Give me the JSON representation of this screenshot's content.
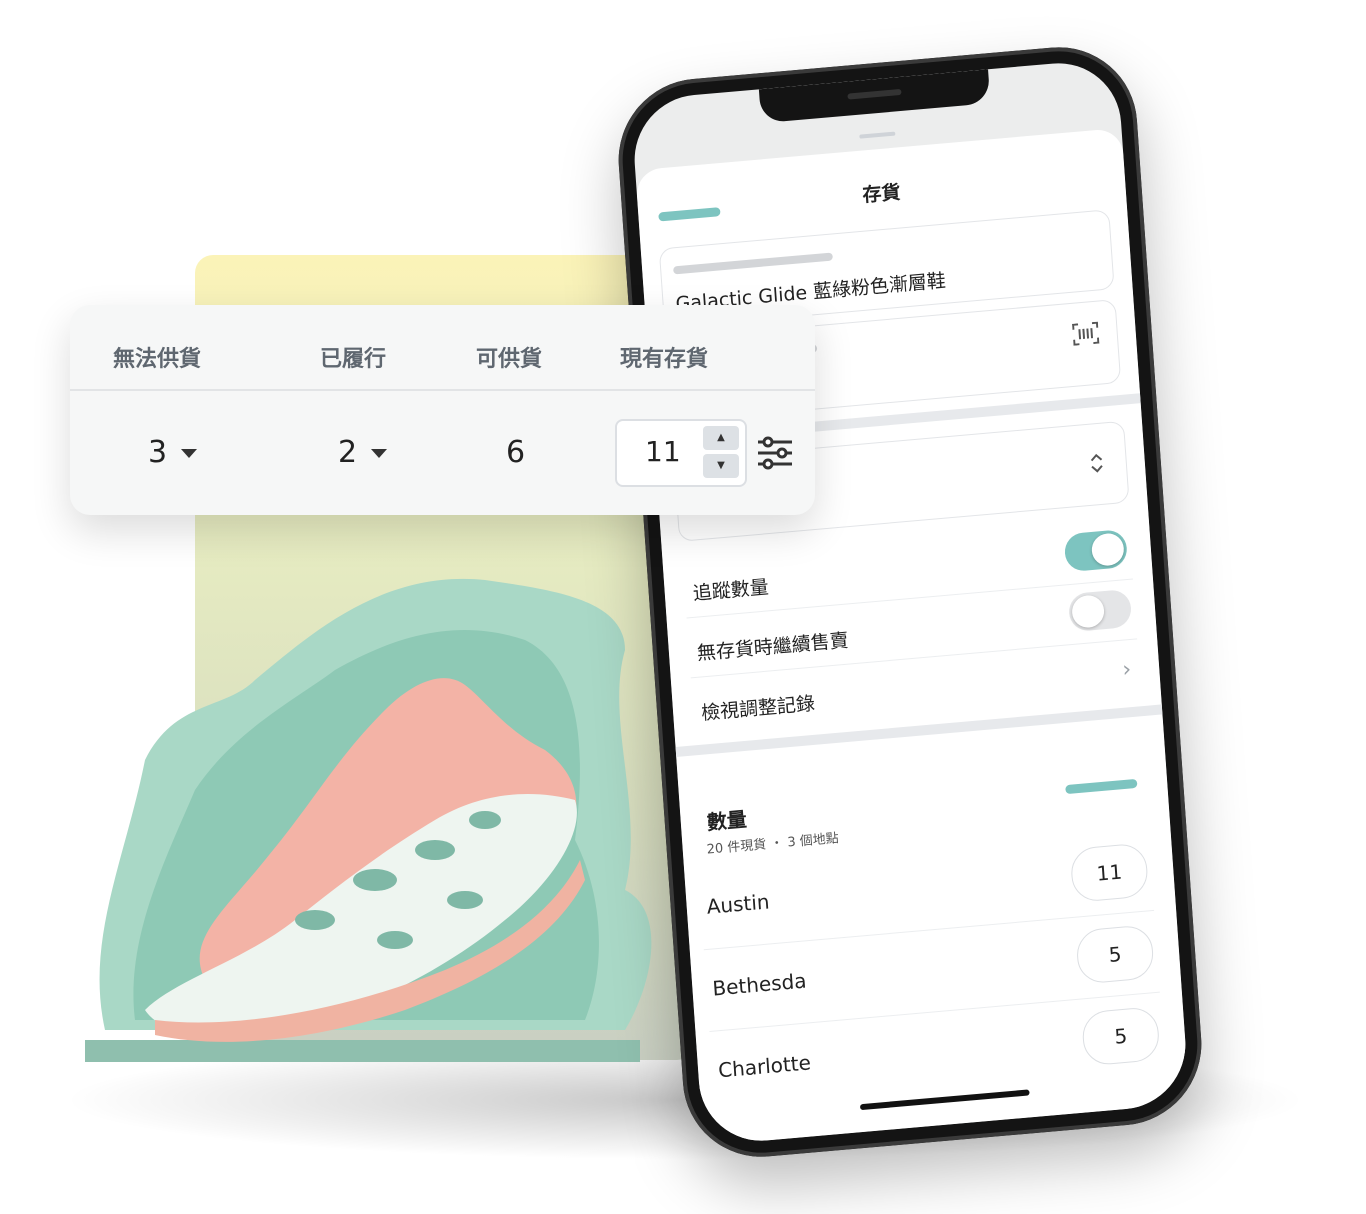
{
  "inventory_card": {
    "headers": [
      "無法供貨",
      "已履行",
      "可供貨",
      "現有存貨"
    ],
    "unavailable": "3",
    "committed": "2",
    "available": "6",
    "on_hand": "11"
  },
  "phone": {
    "title": "存貨",
    "product_name": "Galactic Glide 藍綠粉色漸層鞋",
    "toggles": [
      {
        "label": "追蹤數量",
        "on": true
      },
      {
        "label": "無存貨時繼續售賣",
        "on": false
      }
    ],
    "history_link": "檢視調整記錄",
    "quantity": {
      "title": "數量",
      "subtitle": "20 件現貨 ・ 3 個地點",
      "locations": [
        {
          "name": "Austin",
          "value": "11"
        },
        {
          "name": "Bethesda",
          "value": "5"
        },
        {
          "name": "Charlotte",
          "value": "5"
        }
      ]
    }
  },
  "colors": {
    "accent": "#7dc4c0",
    "toggle_off": "#e4e5e7"
  }
}
